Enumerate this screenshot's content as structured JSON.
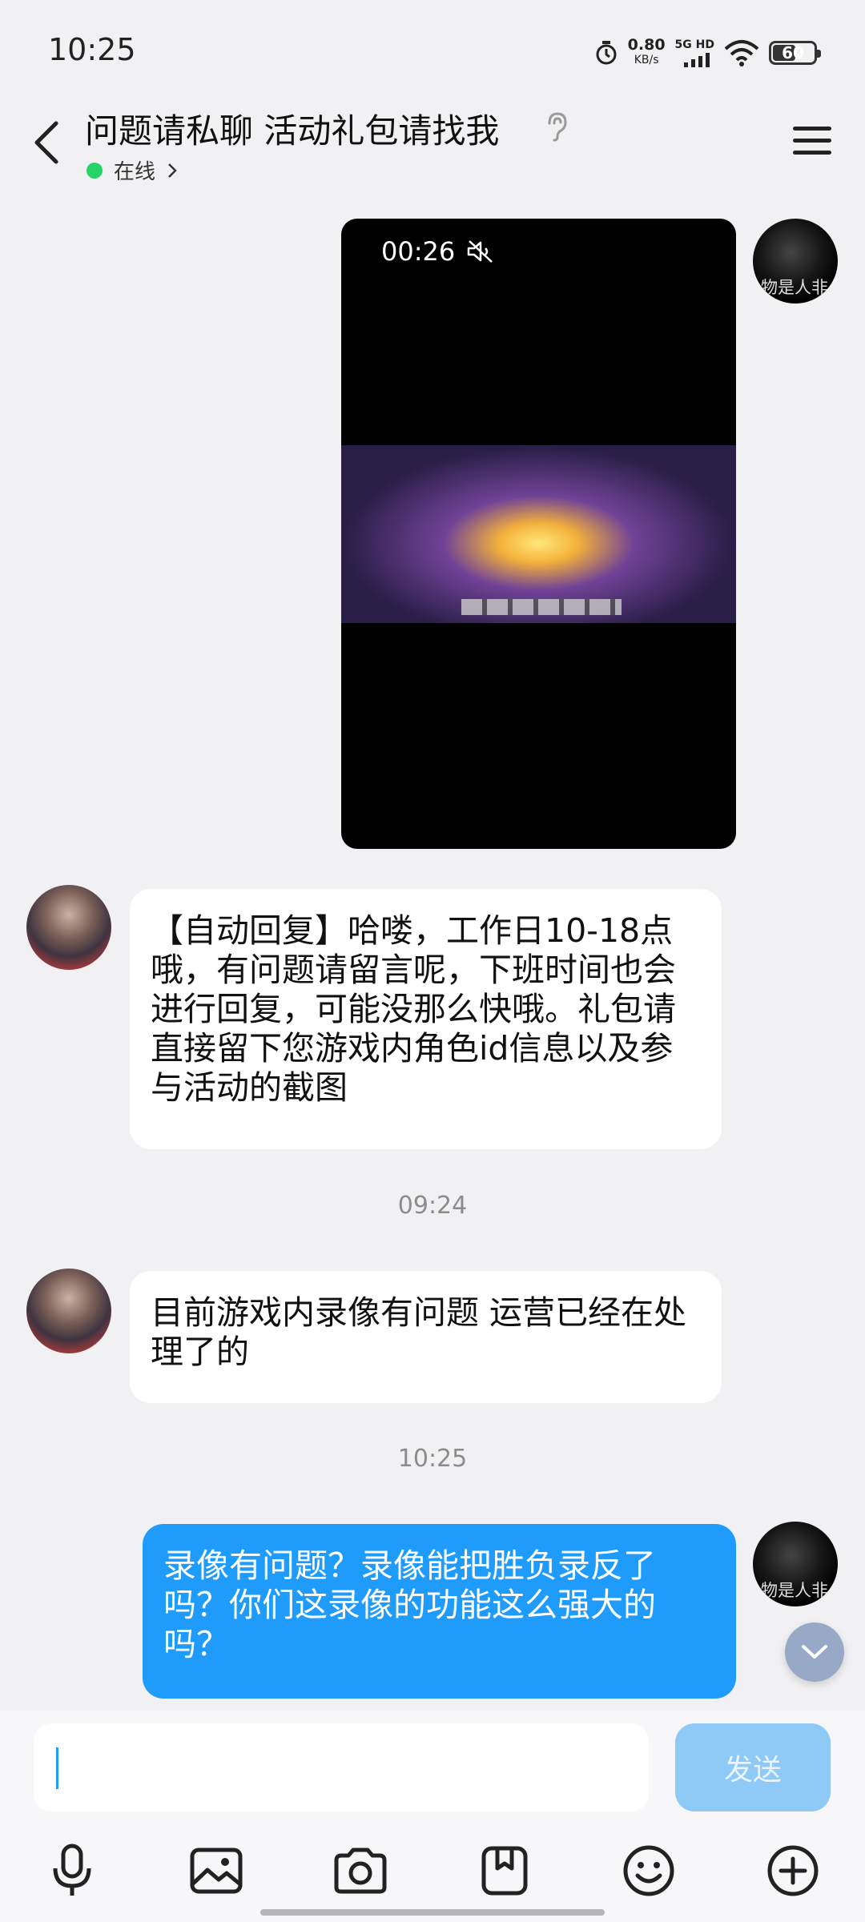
{
  "status": {
    "time": "10:25",
    "net_speed": "0.80",
    "net_unit": "KB/s",
    "signal_label": "5G HD",
    "battery": "60",
    "battery_level": 0.6
  },
  "header": {
    "title": "问题请私聊 活动礼包请找我",
    "status": "在线",
    "status_color": "#25d366"
  },
  "messages": {
    "video": {
      "duration": "00:26"
    },
    "auto_reply": "【自动回复】哈喽，工作日10-18点哦，有问题请留言呢，下班时间也会进行回复，可能没那么快哦。礼包请直接留下您游戏内角色id信息以及参与活动的截图",
    "time1": "09:24",
    "reply1": "目前游戏内录像有问题 运营已经在处理了的",
    "time2": "10:25",
    "mine": "录像有问题？录像能把胜负录反了吗？你们这录像的功能这么强大的吗？",
    "avatar_caption": "物是人非"
  },
  "input": {
    "placeholder": "",
    "send_label": "发送"
  },
  "colors": {
    "bubble_out": "#1e9bfb",
    "send_button": "#8fcaf7"
  },
  "icons": [
    "back-icon",
    "hearing-icon",
    "menu-icon",
    "mute-icon",
    "microphone-icon",
    "image-icon",
    "camera-icon",
    "sticker-icon",
    "emoji-icon",
    "plus-icon",
    "chevron-down-icon"
  ]
}
